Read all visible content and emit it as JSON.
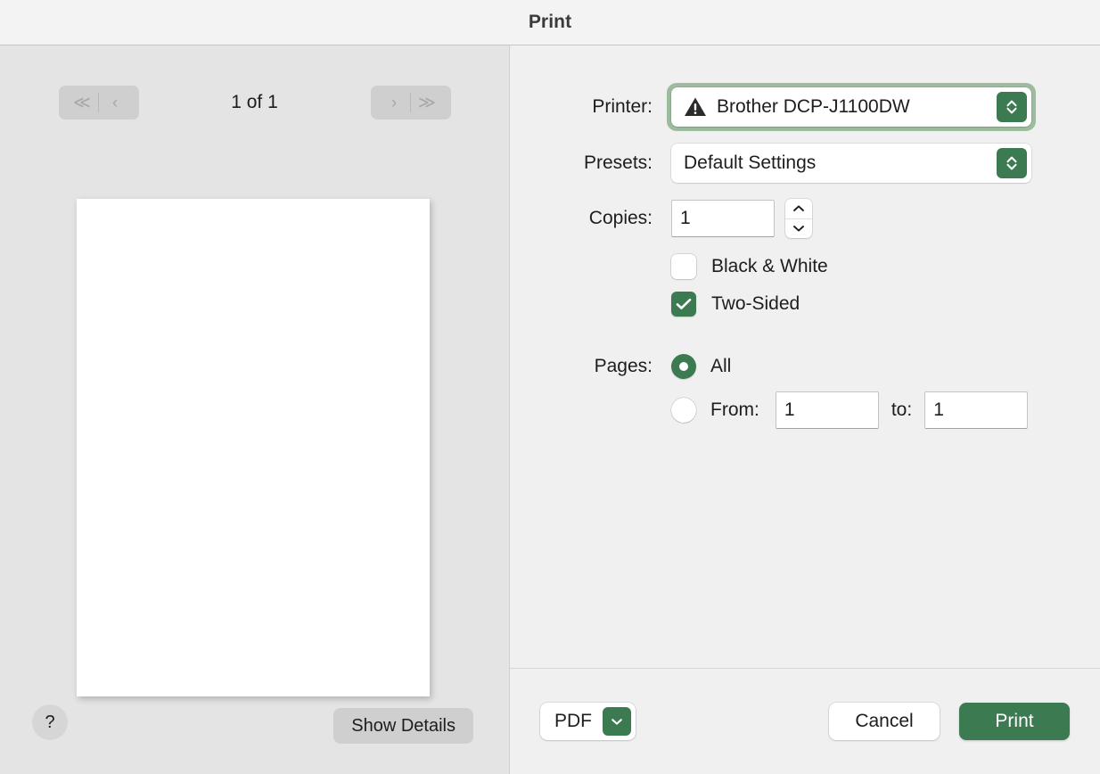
{
  "window": {
    "title": "Print"
  },
  "preview": {
    "nav": {
      "first_icon": "chevron-double-left-icon",
      "prev_icon": "chevron-left-icon",
      "next_icon": "chevron-right-icon",
      "last_icon": "chevron-double-right-icon",
      "first_glyph": "≪",
      "prev_glyph": "‹",
      "next_glyph": "›",
      "last_glyph": "≫",
      "page_counter": "1 of 1"
    },
    "help_label": "?",
    "show_details_label": "Show Details"
  },
  "settings": {
    "printer": {
      "label": "Printer:",
      "value": "Brother DCP-J1100DW",
      "status_icon": "warning-triangle-icon",
      "focused": true
    },
    "presets": {
      "label": "Presets:",
      "value": "Default Settings"
    },
    "copies": {
      "label": "Copies:",
      "value": "1"
    },
    "black_and_white": {
      "label": "Black & White",
      "checked": false
    },
    "two_sided": {
      "label": "Two-Sided",
      "checked": true
    },
    "pages": {
      "label": "Pages:",
      "all_label": "All",
      "from_label": "From:",
      "to_label": "to:",
      "from_value": "1",
      "to_value": "1",
      "selected": "all"
    }
  },
  "footer": {
    "pdf_label": "PDF",
    "pdf_arrow_icon": "chevron-down-icon",
    "cancel_label": "Cancel",
    "print_label": "Print"
  },
  "colors": {
    "accent_green": "#3c7a52",
    "focus_ring": "#9dbb9d",
    "window_bg": "#f0f0f0",
    "preview_bg": "#e4e4e4"
  }
}
